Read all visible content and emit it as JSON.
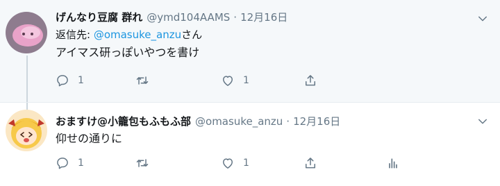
{
  "tweets": [
    {
      "display_name": "げんなり豆腐 群れ",
      "handle": "@ymd104AAMS",
      "separator": "·",
      "date": "12月16日",
      "reply_prefix": "返信先: ",
      "reply_mention": "@omasuke_anzu",
      "reply_suffix": "さん",
      "text": "アイマス研っぽいやつを書け",
      "reply_count": "1",
      "retweet_count": "",
      "like_count": "1"
    },
    {
      "display_name": "おますけ@小籠包もふもふ部",
      "handle": "@omasuke_anzu",
      "separator": "·",
      "date": "12月16日",
      "text": "仰せの通りに",
      "reply_count": "1",
      "retweet_count": "",
      "like_count": "1"
    }
  ],
  "icons": [
    "reply-icon",
    "retweet-icon",
    "like-icon",
    "share-icon",
    "analytics-icon",
    "chevron-down-icon"
  ],
  "colors": {
    "accent": "#1b95e0",
    "muted": "#657786",
    "thread_bg": "#f5f8fa"
  }
}
